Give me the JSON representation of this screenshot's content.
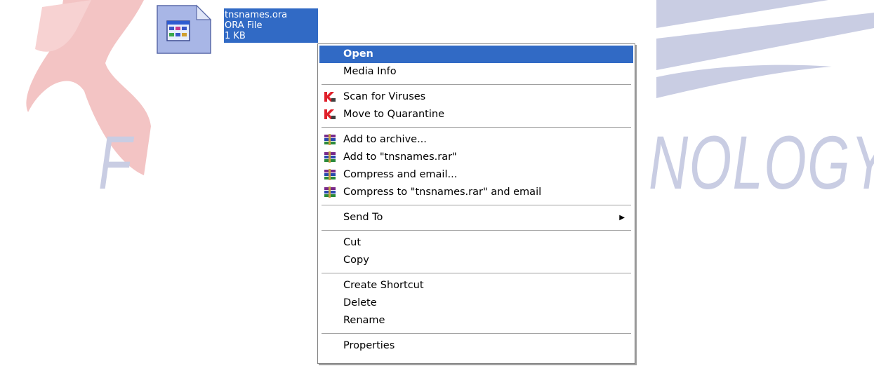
{
  "watermark": {
    "left_text": "F",
    "right_text": "NOLOGY",
    "color": "#c9cde3",
    "accent_color": "#f3c4c4"
  },
  "file": {
    "name": "tnsnames.ora",
    "type": "ORA File",
    "size": "1 KB",
    "icon": "ora-file-icon",
    "selection_color": "#316ac5"
  },
  "context_menu": {
    "highlight_color": "#316ac5",
    "items": {
      "open": "Open",
      "media_info": "Media Info",
      "scan_viruses": "Scan for Viruses",
      "move_quarantine": "Move to Quarantine",
      "add_archive": "Add to archive...",
      "add_to_rar": "Add to \"tnsnames.rar\"",
      "compress_email": "Compress and email...",
      "compress_rar_email": "Compress to \"tnsnames.rar\" and email",
      "send_to": "Send To",
      "cut": "Cut",
      "copy": "Copy",
      "create_shortcut": "Create Shortcut",
      "delete": "Delete",
      "rename": "Rename",
      "properties": "Properties"
    },
    "icons": {
      "kaspersky": "kaspersky-icon",
      "winrar": "winrar-icon",
      "submenu": "chevron-right-icon"
    }
  }
}
